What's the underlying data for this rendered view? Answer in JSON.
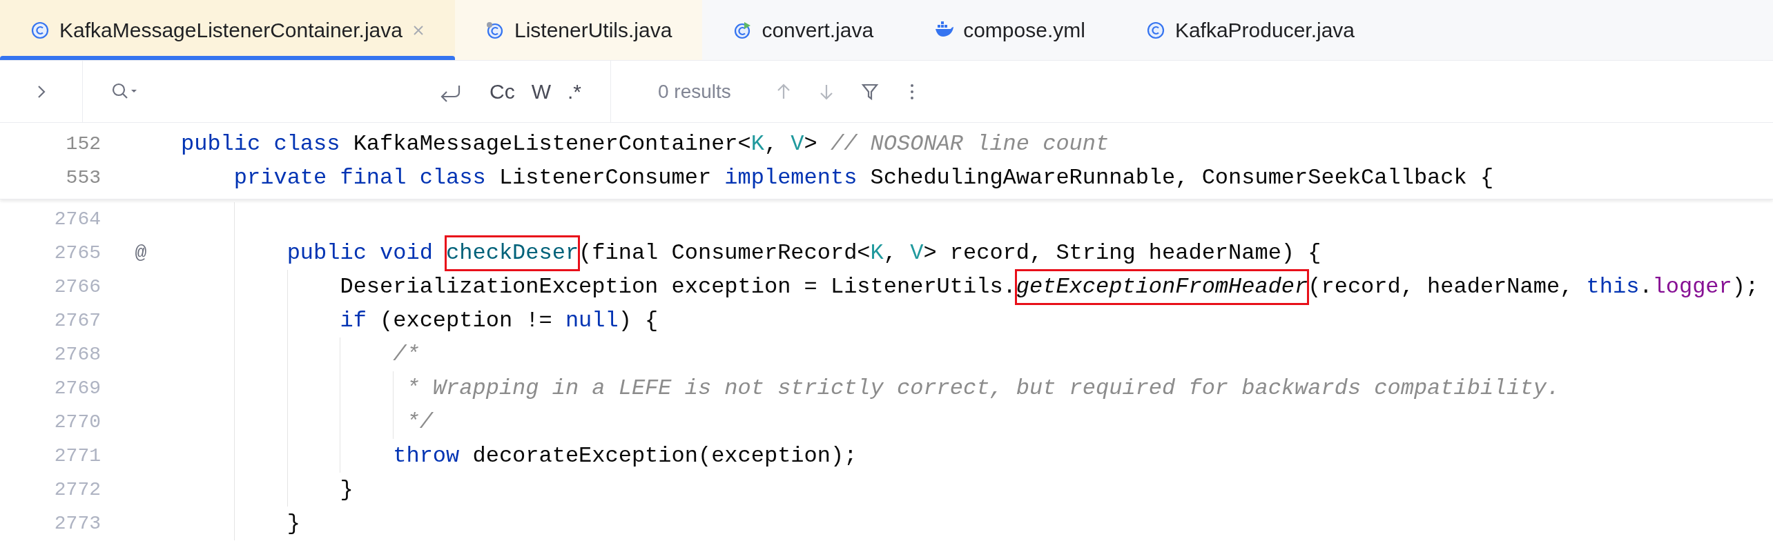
{
  "tabs": [
    {
      "label": "KafkaMessageListenerContainer.java",
      "kind": "class",
      "selected": true,
      "closable": true
    },
    {
      "label": "ListenerUtils.java",
      "kind": "utility",
      "selected": false
    },
    {
      "label": "convert.java",
      "kind": "runnable",
      "selected": false
    },
    {
      "label": "compose.yml",
      "kind": "docker",
      "selected": false
    },
    {
      "label": "KafkaProducer.java",
      "kind": "class",
      "selected": false
    }
  ],
  "search_bar": {
    "options": [
      "Cc",
      "W",
      ".*"
    ],
    "results": "0 results"
  },
  "sticky_lines": [
    {
      "number": "152",
      "tokens": [
        {
          "kind": "kw",
          "text": "public class "
        },
        {
          "kind": "plain",
          "text": "KafkaMessageListenerContainer<"
        },
        {
          "kind": "tp",
          "text": "K"
        },
        {
          "kind": "plain",
          "text": ", "
        },
        {
          "kind": "tp",
          "text": "V"
        },
        {
          "kind": "plain",
          "text": "> "
        },
        {
          "kind": "comment",
          "text": "// NOSONAR line count"
        }
      ]
    },
    {
      "number": "553",
      "tokens": [
        {
          "kind": "kw",
          "text": "    private final class "
        },
        {
          "kind": "plain",
          "text": "ListenerConsumer "
        },
        {
          "kind": "kw",
          "text": "implements "
        },
        {
          "kind": "plain",
          "text": "SchedulingAwareRunnable, ConsumerSeekCallback {"
        }
      ]
    }
  ],
  "lines": [
    {
      "number": "2764"
    },
    {
      "number": "2765",
      "gutter": "@",
      "tokens": [
        {
          "kind": "kw",
          "text": "        public void "
        },
        {
          "kind": "decl",
          "text": "checkDeser",
          "boxed": true
        },
        {
          "kind": "plain",
          "text": "(final ConsumerRecord<"
        },
        {
          "kind": "tp",
          "text": "K"
        },
        {
          "kind": "plain",
          "text": ", "
        },
        {
          "kind": "tp",
          "text": "V"
        },
        {
          "kind": "plain",
          "text": "> record, String headerName) {"
        }
      ]
    },
    {
      "number": "2766",
      "tokens": [
        {
          "kind": "plain",
          "text": "            DeserializationException exception = ListenerUtils."
        },
        {
          "kind": "static",
          "text": "getExceptionFromHeader",
          "boxed": true
        },
        {
          "kind": "plain",
          "text": "(record, headerName, "
        },
        {
          "kind": "kw",
          "text": "this"
        },
        {
          "kind": "plain",
          "text": "."
        },
        {
          "kind": "field",
          "text": "logger"
        },
        {
          "kind": "plain",
          "text": ");"
        }
      ]
    },
    {
      "number": "2767",
      "tokens": [
        {
          "kind": "kw",
          "text": "            if "
        },
        {
          "kind": "plain",
          "text": "(exception != "
        },
        {
          "kind": "kw",
          "text": "null"
        },
        {
          "kind": "plain",
          "text": ") {"
        }
      ]
    },
    {
      "number": "2768",
      "tokens": [
        {
          "kind": "comment",
          "text": "                /*"
        }
      ]
    },
    {
      "number": "2769",
      "tokens": [
        {
          "kind": "comment",
          "text": "                 * Wrapping in a LEFE is not strictly correct, but required for backwards compatibility."
        }
      ]
    },
    {
      "number": "2770",
      "tokens": [
        {
          "kind": "comment",
          "text": "                 */"
        }
      ]
    },
    {
      "number": "2771",
      "tokens": [
        {
          "kind": "kw",
          "text": "                throw "
        },
        {
          "kind": "plain",
          "text": "decorateException(exception);"
        }
      ]
    },
    {
      "number": "2772",
      "tokens": [
        {
          "kind": "plain",
          "text": "            }"
        }
      ]
    },
    {
      "number": "2773",
      "tokens": [
        {
          "kind": "plain",
          "text": "        }"
        }
      ]
    }
  ]
}
